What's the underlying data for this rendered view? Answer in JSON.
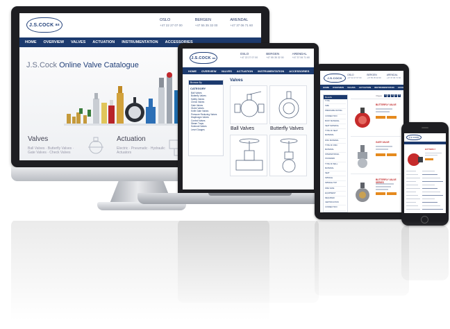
{
  "site": {
    "logo_text": "J.S.COCK",
    "logo_mark": "as"
  },
  "cities": [
    {
      "name": "OSLO",
      "phone": "+47 22 27 07 00"
    },
    {
      "name": "BERGEN",
      "phone": "+47 55 35 32 00"
    },
    {
      "name": "ARENDAL",
      "phone": "+47 37 06 71 60"
    }
  ],
  "nav": [
    "HOME",
    "OVERVIEW",
    "VALVES",
    "ACTUATION",
    "INSTRUMENTATION",
    "ACCESSORIES"
  ],
  "desktop": {
    "catalogue_prefix": "J.S.Cock",
    "catalogue_title": "Online Valve Catalogue",
    "categories": [
      {
        "label": "Valves",
        "sub": "Ball Valves · Butterfly Valves · Gate Valves · Check Valves"
      },
      {
        "label": "Actuation",
        "sub": "Electric · Pneumatic · Hydraulic Actuators"
      }
    ]
  },
  "laptop": {
    "browse_by": "Browse By",
    "category_heading": "CATEGORY",
    "category_items": [
      "Ball Valves",
      "Butterfly Valves",
      "Safety Valves",
      "Check Valves",
      "Gate Valves",
      "Globe Valves",
      "Knife Gate Valves",
      "Pressure Reducing Valves",
      "Diaphragm Valves",
      "Control Valves",
      "Steam Traps",
      "Solenoid Valves",
      "Level Gauges"
    ],
    "section_title": "Valves",
    "tiles": [
      {
        "label": "Ball Valves"
      },
      {
        "label": "Butterfly Valves"
      }
    ]
  },
  "tablet": {
    "filter_heading": "Results",
    "filter_items": [
      "TYPE",
      "SIZE",
      "PRESSURE RATING",
      "CONNECTION",
      "BODY MATERIAL",
      "SEAT MATERIAL",
      "TYPE OF SEAT MATERIAL",
      "DISC MATERIAL",
      "TYPE OF DISC MATERIAL",
      "INTERNATIONAL STANDARD",
      "TYPE OF BALL MATERIAL",
      "SEAT",
      "SPINDLE",
      "SPINDLE TOP",
      "FIRE SAFE",
      "EQUIPMENT",
      "REQUIRED CERTIFICATION",
      "CONNECTION"
    ],
    "pager_label": "Pages",
    "pages": [
      "1",
      "2",
      "3",
      "4",
      "5"
    ],
    "products": [
      {
        "title": "BUTTERFLY VALVE"
      },
      {
        "title": "GATE VALVE"
      },
      {
        "title": "BUTTERFLY VALVE SERIES"
      }
    ]
  },
  "phone": {
    "product_title": "BUTTERFLY"
  },
  "colors": {
    "navy": "#1c3a6e",
    "accent_red": "#c0292b",
    "button_orange": "#e58a1e"
  }
}
